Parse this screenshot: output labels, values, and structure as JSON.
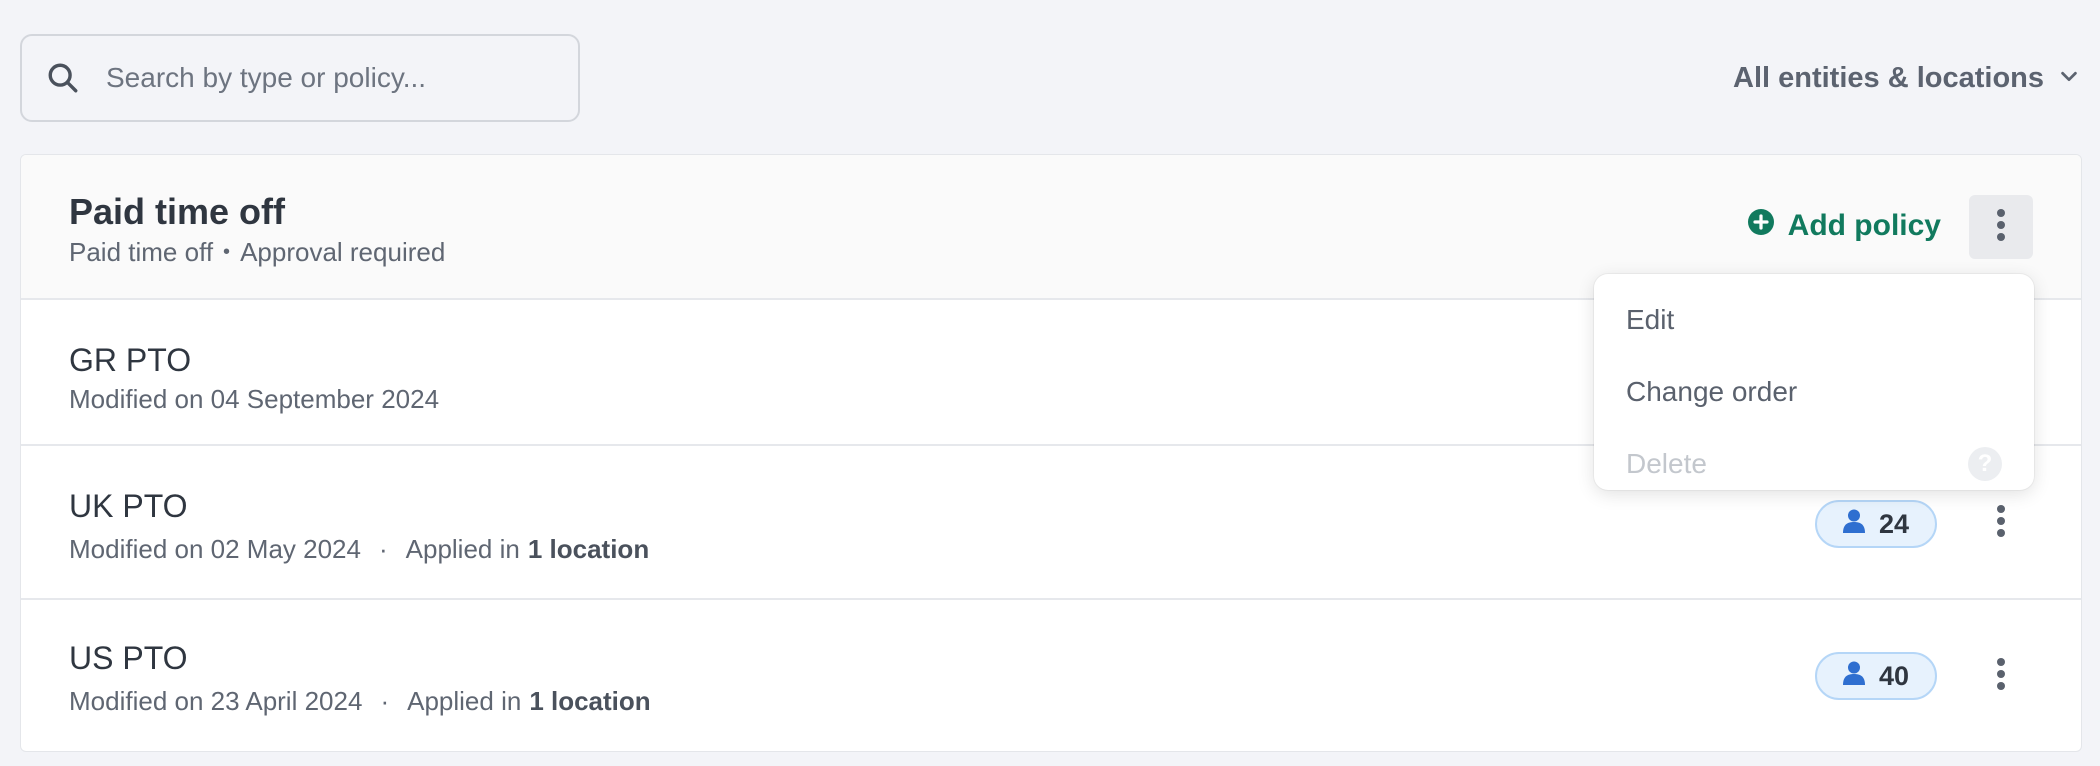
{
  "search": {
    "placeholder": "Search by type or policy...",
    "value": "",
    "icon": "search-icon"
  },
  "filter": {
    "label": "All entities & locations",
    "icon": "chevron-down-icon"
  },
  "group": {
    "title": "Paid time off",
    "subtitle_type": "Paid time off",
    "subtitle_separator": "•",
    "subtitle_approval": "Approval required",
    "add_policy_label": "Add policy",
    "add_icon": "plus-circle-icon",
    "accent_color": "#117a5e"
  },
  "policies": [
    {
      "name": "GR PTO",
      "modified": "Modified on 04 September 2024",
      "applied_prefix": "",
      "applied_value": "",
      "count": ""
    },
    {
      "name": "UK PTO",
      "modified": "Modified on 02 May 2024",
      "separator": "·",
      "applied_prefix": "Applied in",
      "applied_value": "1 location",
      "count": "24"
    },
    {
      "name": "US PTO",
      "modified": "Modified on 23 April 2024",
      "separator": "·",
      "applied_prefix": "Applied in",
      "applied_value": "1 location",
      "count": "40"
    }
  ],
  "menu": {
    "items": [
      {
        "label": "Edit",
        "disabled": false
      },
      {
        "label": "Change order",
        "disabled": false
      },
      {
        "label": "Delete",
        "disabled": true,
        "help": "?"
      }
    ]
  },
  "colors": {
    "background": "#f3f4f8",
    "badge_bg": "#e7f2fd",
    "badge_border": "#b5d6f7",
    "person_icon": "#2f6fd0"
  }
}
